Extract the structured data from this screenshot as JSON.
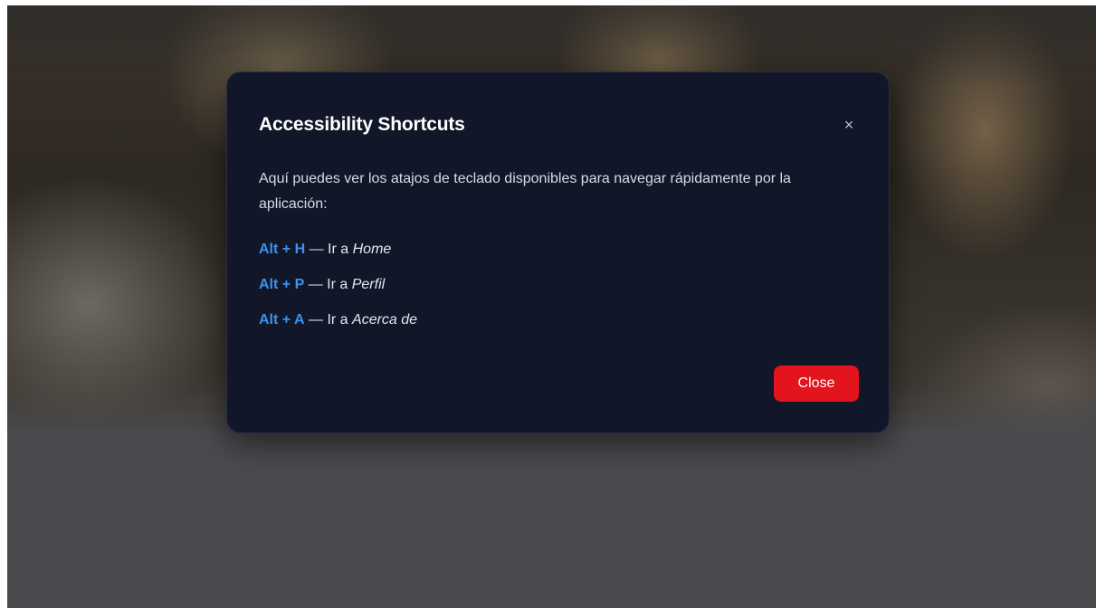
{
  "modal": {
    "title": "Accessibility Shortcuts",
    "close_icon_glyph": "×",
    "intro": "Aquí puedes ver los atajos de teclado disponibles para navegar rápidamente por la aplicación:",
    "shortcuts": [
      {
        "key": "Alt + H",
        "separator": "—",
        "prefix": "Ir a",
        "destination": "Home"
      },
      {
        "key": "Alt + P",
        "separator": "—",
        "prefix": "Ir a",
        "destination": "Perfil"
      },
      {
        "key": "Alt + A",
        "separator": "—",
        "prefix": "Ir a",
        "destination": "Acerca de"
      }
    ],
    "close_button_label": "Close"
  },
  "colors": {
    "modal_background": "#111628",
    "shortcut_key": "#3b93f0",
    "close_button": "#e4141e",
    "overlay": "#4a4a4f"
  },
  "icons": {
    "close": "close-icon"
  }
}
